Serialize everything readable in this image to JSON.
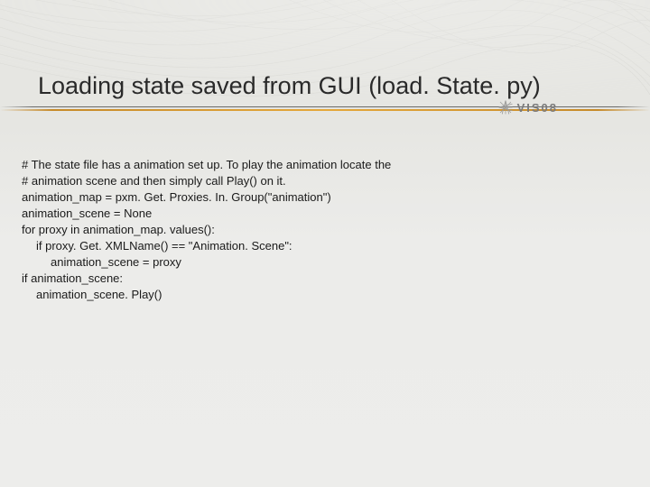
{
  "title": "Loading state saved from GUI (load. State. py)",
  "logo": {
    "text": "VIS08"
  },
  "code": {
    "l1": "# The state file has a animation set up. To play the animation locate the",
    "l2": "# animation scene and then simply call Play() on it.",
    "l3": "animation_map = pxm. Get. Proxies. In. Group(\"animation\")",
    "l4": "animation_scene = None",
    "l5": "for proxy in animation_map. values():",
    "l6": "if proxy. Get. XMLName() == \"Animation. Scene\":",
    "l7": "animation_scene = proxy",
    "l8": "if animation_scene:",
    "l9": "animation_scene. Play()"
  }
}
